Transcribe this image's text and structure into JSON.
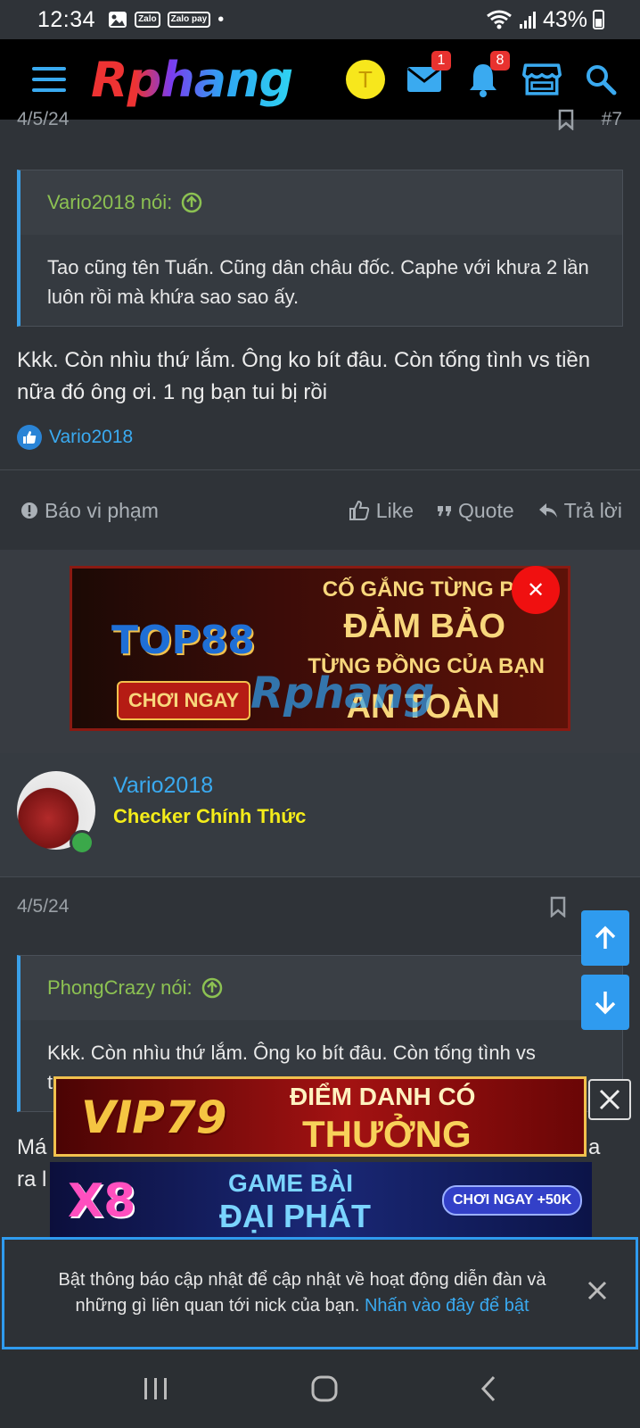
{
  "status_bar": {
    "time": "12:34",
    "zalo_label": "Zalo pay",
    "dot": "•",
    "battery": "43%"
  },
  "header": {
    "logo": "Rphang",
    "user_initial": "T",
    "messages_badge": "1",
    "alerts_badge": "8"
  },
  "post1": {
    "date": "4/5/24",
    "number": "#7",
    "quote_author": "Vario2018 nói:",
    "quote_text": "Tao cũng tên Tuấn. Cũng dân châu đốc. Caphe với khưa 2 lần luôn rồi mà khứa sao sao ấy.",
    "text": "Kkk. Còn nhìu thứ lắm. Ông ko bít đâu. Còn tống tình vs tiền nữa đó ông ơi. 1 ng bạn tui bị rồi",
    "reaction_user": "Vario2018",
    "report_label": "Báo vi phạm",
    "like_label": "Like",
    "quote_label": "Quote",
    "reply_label": "Trả lời"
  },
  "ad1": {
    "brand": "TOP88",
    "play_label": "CHƠI NGAY",
    "line1": "CỐ GẮNG TỪNG PHÚ",
    "line2": "ĐẢM BẢO",
    "line3": "TỪNG ĐỒNG CỦA BẠN",
    "line4": "AN TOÀN",
    "watermark": "Rphang"
  },
  "post2": {
    "author": "Vario2018",
    "rank": "Checker Chính Thức",
    "date": "4/5/24",
    "quote_author": "PhongCrazy nói:",
    "quote_text": "Kkk. Còn nhìu thứ lắm. Ông ko bít đâu. Còn tống tình vs",
    "quote_text_cut": "t",
    "text_start": "Má",
    "text_end": "ra l",
    "text_tail": "a"
  },
  "ad2": {
    "brand": "VIP79",
    "line1": "ĐIỂM DANH CÓ",
    "line2": "THƯỞNG"
  },
  "ad3": {
    "brand": "X8",
    "line1": "GAME BÀI",
    "line2": "ĐẠI PHÁT",
    "cta": "CHƠI NGAY +50K"
  },
  "notice": {
    "text": "Bật thông báo cập nhật để cập nhật về hoạt động diễn đàn và những gì liên quan tới nick của bạn.",
    "link": "Nhấn vào đây để bật"
  },
  "colors": {
    "accent": "#3aaaf0",
    "quote_green": "#8cc152",
    "rank_yellow": "#f4ec1a",
    "badge_red": "#e8322f"
  }
}
